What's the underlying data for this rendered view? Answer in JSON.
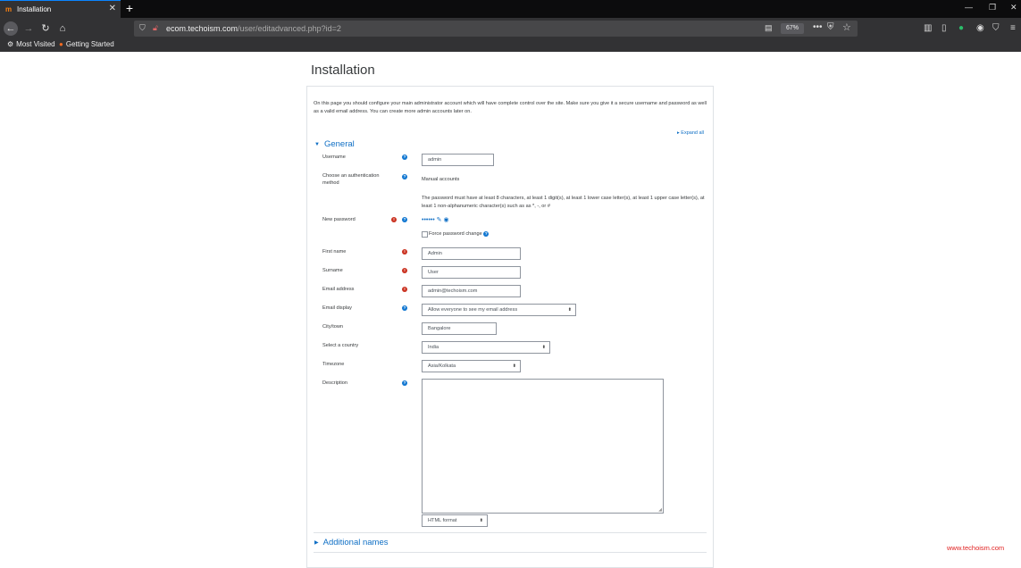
{
  "browser": {
    "tab_title": "Installation",
    "tab_favicon": "moodle-icon",
    "new_tab_label": "+",
    "url_host": "ecom.techoism.com",
    "url_path": "/user/editadvanced.php?id=2",
    "zoom_level": "67%",
    "bookmarks": [
      "Most Visited",
      "Getting Started"
    ]
  },
  "page": {
    "heading": "Installation",
    "intro": "On this page you should configure your main administrator account which will have complete control over the site. Make sure you give it a secure username and password as well as a valid email address. You can create more admin accounts later on.",
    "expand_all": "Expand all",
    "section_general": "General",
    "section_additional": "Additional names"
  },
  "form": {
    "username_label": "Username",
    "username_value": "admin",
    "auth_label": "Choose an authentication method",
    "auth_value": "Manual accounts",
    "password_rules": "The password must have at least 8 characters, at least 1 digit(s), at least 1 lower case letter(s), at least 1 upper case letter(s), at least 1 non-alphanumeric character(s) such as as *, -, or #",
    "new_password_label": "New password",
    "new_password_mask": "••••••",
    "force_change_label": "Force password change",
    "firstname_label": "First name",
    "firstname_value": "Admin",
    "surname_label": "Surname",
    "surname_value": "User",
    "email_label": "Email address",
    "email_value": "admin@techoism.com",
    "email_display_label": "Email display",
    "email_display_value": "Allow everyone to see my email address",
    "city_label": "City/town",
    "city_value": "Bangalore",
    "country_label": "Select a country",
    "country_value": "India",
    "timezone_label": "Timezone",
    "timezone_value": "Asia/Kolkata",
    "description_label": "Description",
    "format_value": "HTML format"
  },
  "watermark": "www.techoism.com",
  "colors": {
    "link": "#0f6fc5",
    "required": "#ca3120",
    "help": "#1177d1"
  }
}
